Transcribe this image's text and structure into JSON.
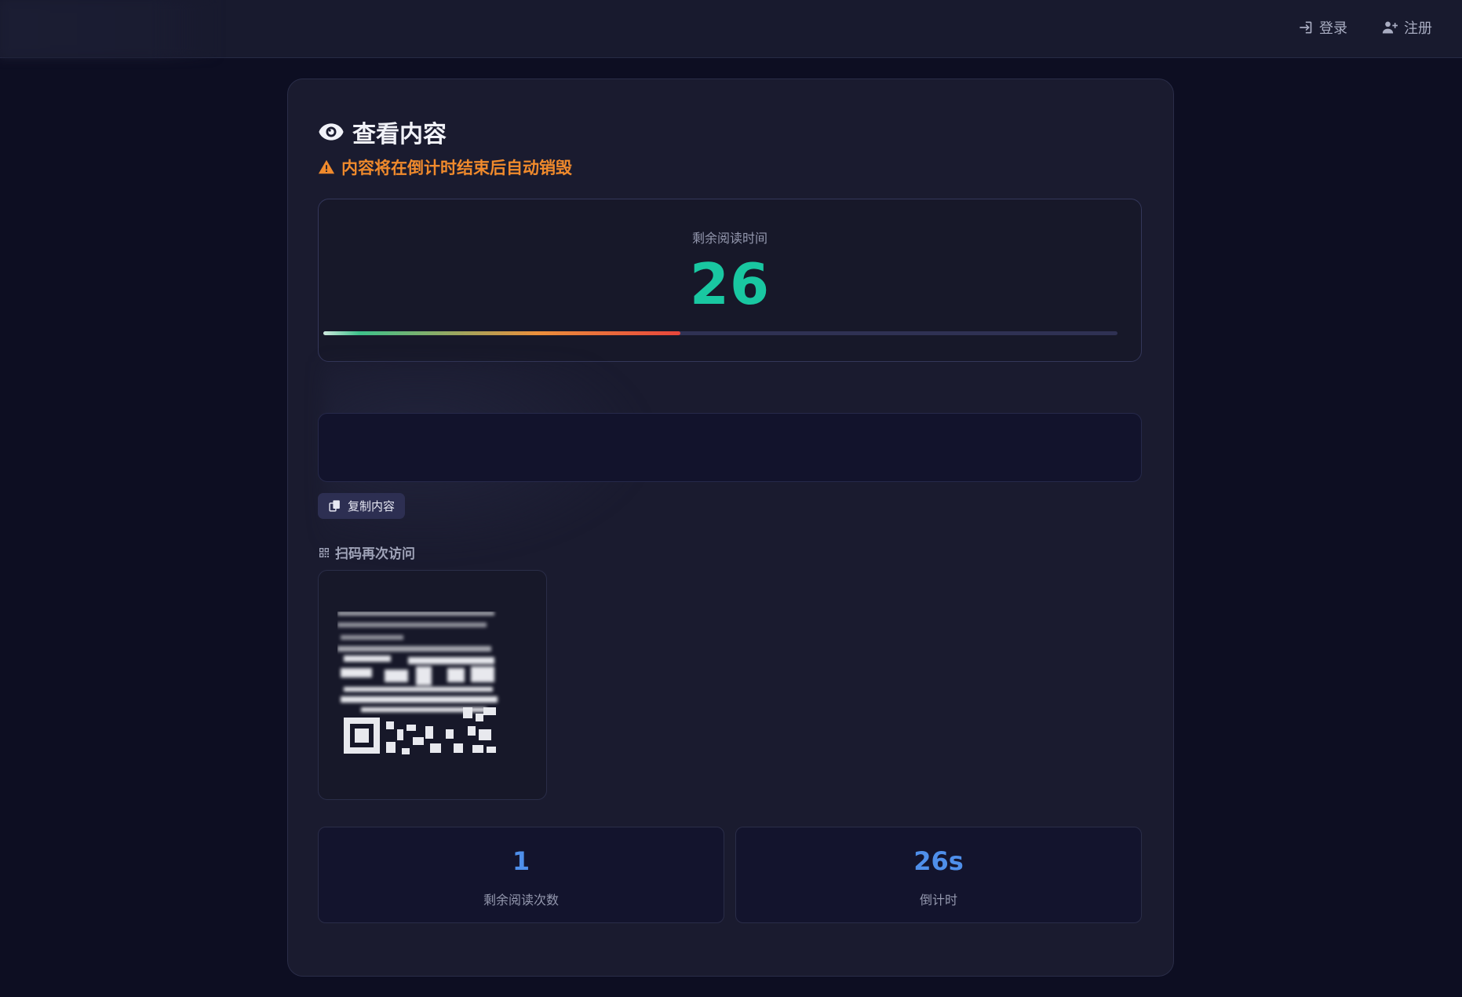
{
  "nav": {
    "login_label": "登录",
    "register_label": "注册"
  },
  "card": {
    "title": "查看内容",
    "warning": "内容将在倒计时结束后自动销毁"
  },
  "timer": {
    "label": "剩余阅读时间",
    "value": "26",
    "progress_fraction": 0.45
  },
  "actions": {
    "copy_label": "复制内容"
  },
  "qr": {
    "label": "扫码再次访问"
  },
  "stats": {
    "remaining_reads": "1",
    "remaining_reads_label": "剩余阅读次数",
    "countdown": "26s",
    "countdown_label": "倒计时"
  },
  "colors": {
    "accent_green": "#19c7a1",
    "warning_orange": "#f08a2c",
    "stat_blue": "#4f8fea",
    "background": "#0d0e22",
    "card": "#1a1b2f"
  },
  "icons": {
    "login": "sign-in-icon",
    "register": "user-plus-icon",
    "title": "eye-icon",
    "warning": "warning-triangle-icon",
    "copy": "copy-icon",
    "qr": "qrcode-icon"
  }
}
